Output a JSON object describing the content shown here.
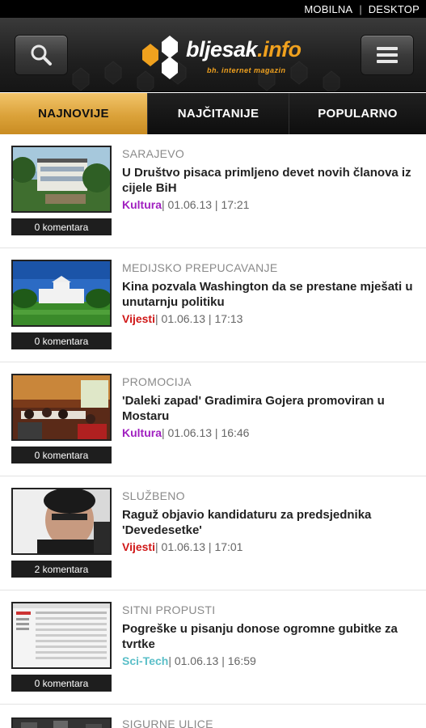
{
  "topbar": {
    "mobilna": "MOBILNA",
    "separator": "|",
    "desktop": "DESKTOP"
  },
  "header": {
    "logo_main": "bljesak",
    "logo_domain": ".info",
    "logo_tagline": "bh. internet magazin"
  },
  "tabs": [
    {
      "label": "NAJNOVIJE",
      "active": true
    },
    {
      "label": "NAJČITANIJE",
      "active": false
    },
    {
      "label": "POPULARNO",
      "active": false
    }
  ],
  "articles": [
    {
      "kicker": "SARAJEVO",
      "title": "U Društvo pisaca primljeno devet novih članova iz cijele BiH",
      "section": "Kultura",
      "section_color": "#a020c0",
      "meta": "| 01.06.13 | 17:21",
      "comments": "0 komentara"
    },
    {
      "kicker": "MEDIJSKO PREPUCAVANJE",
      "title": "Kina pozvala Washington da se prestane mješati u unutarnju politiku",
      "section": "Vijesti",
      "section_color": "#d01818",
      "meta": "| 01.06.13 | 17:13",
      "comments": "0 komentara"
    },
    {
      "kicker": "PROMOCIJA",
      "title": "'Daleki zapad' Gradimira Gojera promoviran u Mostaru",
      "section": "Kultura",
      "section_color": "#a020c0",
      "meta": "| 01.06.13 | 16:46",
      "comments": "0 komentara"
    },
    {
      "kicker": "SLUŽBENO",
      "title": "Raguž objavio kandidaturu za predsjednika 'Devedesetke'",
      "section": "Vijesti",
      "section_color": "#d01818",
      "meta": "| 01.06.13 | 17:01",
      "comments": "2 komentara"
    },
    {
      "kicker": "SITNI PROPUSTI",
      "title": "Pogreške u pisanju donose ogromne gubitke za tvrtke",
      "section": "Sci-Tech",
      "section_color": "#5bbfc8",
      "meta": "| 01.06.13 | 16:59",
      "comments": "0 komentara"
    },
    {
      "kicker": "SIGURNE ULICE"
    }
  ]
}
